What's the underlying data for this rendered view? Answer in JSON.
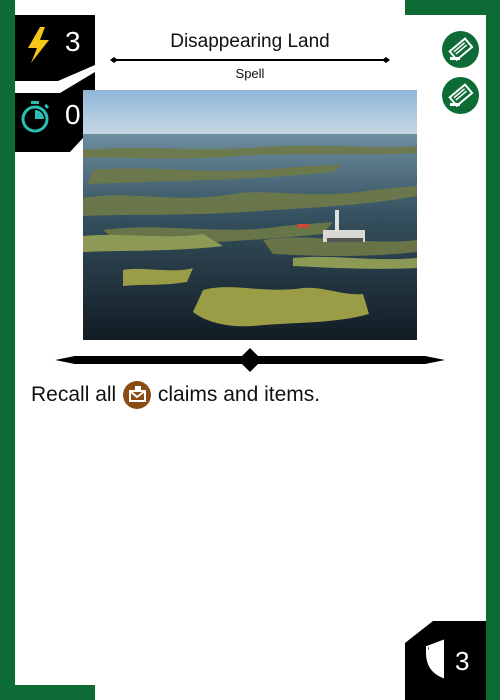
{
  "card": {
    "title": "Disappearing Land",
    "type_line": "Spell",
    "energy_cost": "3",
    "time_cost": "0",
    "shield_value": "3",
    "rules": {
      "before": "Recall all",
      "icon": "claim-icon",
      "after": "claims and items."
    },
    "corner_icons": [
      "card-type-icon",
      "card-type-icon"
    ],
    "colors": {
      "frame": "#0d6b35",
      "badge": "#000000",
      "energy": "#f5c518",
      "time": "#2bbfb3",
      "claim": "#8a4b14"
    }
  }
}
